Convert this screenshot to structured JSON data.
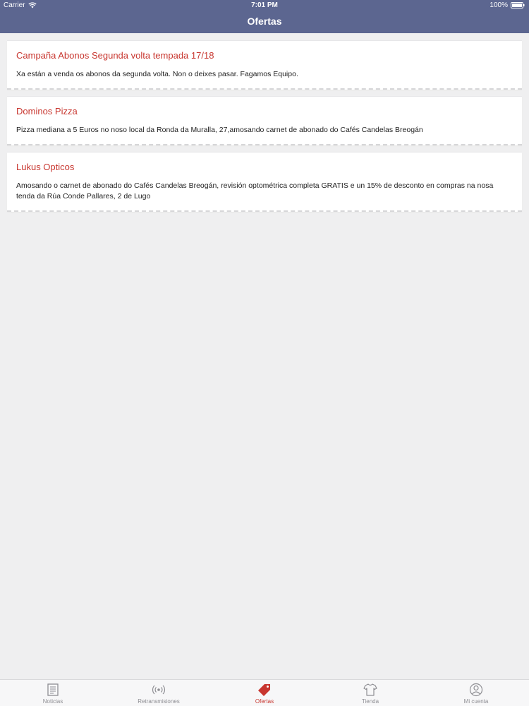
{
  "status": {
    "carrier": "Carrier",
    "time": "7:01 PM",
    "battery": "100%"
  },
  "header": {
    "title": "Ofertas",
    "color": "#5c6690"
  },
  "offers": [
    {
      "title": "Campaña Abonos Segunda volta tempada 17/18",
      "text": "Xa están a venda os abonos da segunda volta. Non o deixes pasar. Fagamos Equipo."
    },
    {
      "title": "Dominos Pizza",
      "text": "Pizza mediana a 5 Euros no noso local da Ronda da Muralla, 27,amosando carnet de abonado do Cafés Candelas Breogán"
    },
    {
      "title": "Lukus Opticos",
      "text": "Amosando o carnet de abonado do Cafés Candelas Breogán, revisión optométrica completa GRATIS e un 15% de desconto en compras na nosa tenda da Rúa Conde Pallares, 2 de Lugo"
    }
  ],
  "tabbar": {
    "active_color": "#c8362f",
    "tabs": [
      {
        "label": "Noticias",
        "icon": "newspaper-icon"
      },
      {
        "label": "Retransmisiones",
        "icon": "broadcast-icon"
      },
      {
        "label": "Ofertas",
        "icon": "tag-icon",
        "active": true
      },
      {
        "label": "Tienda",
        "icon": "tshirt-icon"
      },
      {
        "label": "Mi cuenta",
        "icon": "user-icon"
      }
    ]
  }
}
